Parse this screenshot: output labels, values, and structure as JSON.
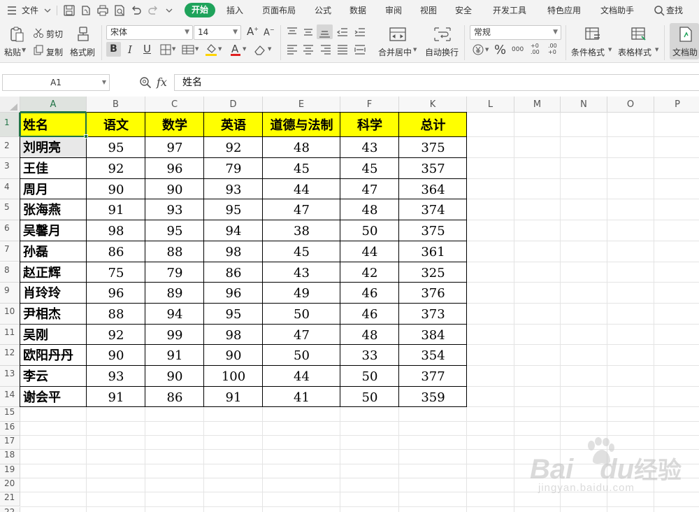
{
  "menubar": {
    "file_label": "文件",
    "tabs": [
      "开始",
      "插入",
      "页面布局",
      "公式",
      "数据",
      "审阅",
      "视图",
      "安全",
      "开发工具",
      "特色应用",
      "文档助手"
    ],
    "active_tab": "开始",
    "search_label": "查找"
  },
  "ribbon": {
    "paste": "粘贴",
    "cut": "剪切",
    "copy": "复制",
    "format_painter": "格式刷",
    "font_name": "宋体",
    "font_size": "14",
    "bold": "B",
    "italic": "I",
    "underline": "U",
    "merge_center": "合并居中",
    "wrap_text": "自动换行",
    "number_format": "常规",
    "percent": "%",
    "thousands": "000",
    "inc_decimal": "+0 .00",
    "dec_decimal": ".00 +0",
    "conditional_format": "条件格式",
    "table_style": "表格样式",
    "doc_helper": "文档助"
  },
  "formula_bar": {
    "name_box": "A1",
    "fx": "fx",
    "content": "姓名"
  },
  "sheet": {
    "columns": [
      "A",
      "B",
      "C",
      "D",
      "E",
      "F",
      "K",
      "L",
      "M",
      "N",
      "O",
      "P"
    ],
    "row_numbers": [
      "1",
      "2",
      "3",
      "4",
      "5",
      "6",
      "7",
      "8",
      "9",
      "10",
      "11",
      "12",
      "13",
      "14",
      "15",
      "16",
      "17",
      "18",
      "19",
      "20",
      "21",
      "22"
    ],
    "header": [
      "姓名",
      "语文",
      "数学",
      "英语",
      "道德与法制",
      "科学",
      "总计"
    ],
    "rows": [
      [
        "刘明亮",
        "95",
        "97",
        "92",
        "48",
        "43",
        "375"
      ],
      [
        "王佳",
        "92",
        "96",
        "79",
        "45",
        "45",
        "357"
      ],
      [
        "周月",
        "90",
        "90",
        "93",
        "44",
        "47",
        "364"
      ],
      [
        "张海燕",
        "91",
        "93",
        "95",
        "47",
        "48",
        "374"
      ],
      [
        "吴馨月",
        "98",
        "95",
        "94",
        "38",
        "50",
        "375"
      ],
      [
        "孙磊",
        "86",
        "88",
        "98",
        "45",
        "44",
        "361"
      ],
      [
        "赵正辉",
        "75",
        "79",
        "86",
        "43",
        "42",
        "325"
      ],
      [
        "肖玲玲",
        "96",
        "89",
        "96",
        "49",
        "46",
        "376"
      ],
      [
        "尹相杰",
        "88",
        "94",
        "95",
        "50",
        "46",
        "373"
      ],
      [
        "吴刚",
        "92",
        "99",
        "98",
        "47",
        "48",
        "384"
      ],
      [
        "欧阳丹丹",
        "90",
        "91",
        "90",
        "50",
        "33",
        "354"
      ],
      [
        "李云",
        "93",
        "90",
        "100",
        "44",
        "50",
        "377"
      ],
      [
        "谢会平",
        "91",
        "86",
        "91",
        "41",
        "50",
        "359"
      ]
    ],
    "header_fill": "#ffff00",
    "selection_color": "#217346"
  },
  "watermark": {
    "brand": "Bai",
    "brand2": "du",
    "cn": "经验",
    "url": "jingyan.baidu.com"
  }
}
